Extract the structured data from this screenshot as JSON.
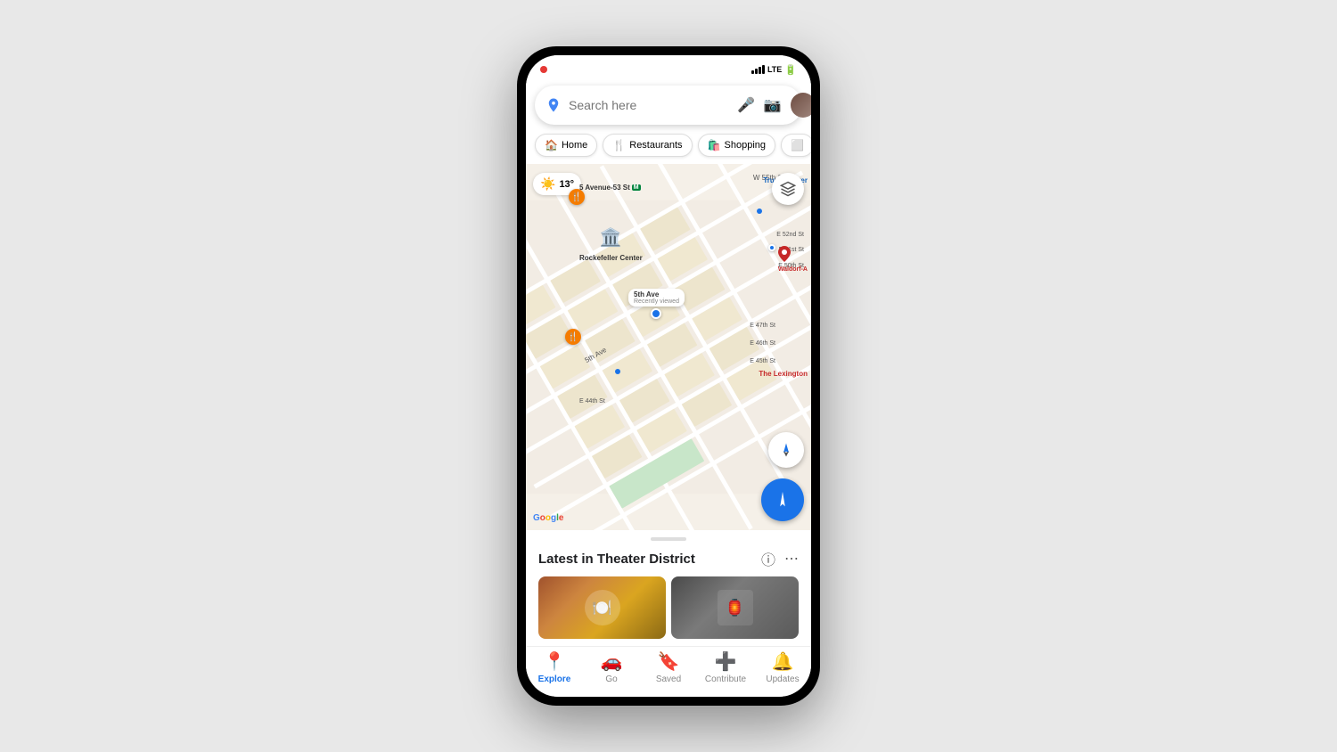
{
  "statusBar": {
    "signal": "LTE",
    "battery": "🔋"
  },
  "searchBar": {
    "placeholder": "Search here",
    "micLabel": "mic",
    "cameraLabel": "camera"
  },
  "chips": [
    {
      "id": "home",
      "icon": "🏠",
      "label": "Home"
    },
    {
      "id": "restaurants",
      "icon": "🍴",
      "label": "Restaurants"
    },
    {
      "id": "shopping",
      "icon": "🛍️",
      "label": "Shopping"
    }
  ],
  "map": {
    "weather": "13°",
    "labels": [
      {
        "text": "Rockefeller Center",
        "type": "landmark"
      },
      {
        "text": "5th Ave",
        "type": "street"
      },
      {
        "text": "Recently viewed",
        "type": "pin"
      },
      {
        "text": "Trump Tower",
        "type": "landmark-blue"
      },
      {
        "text": "Waldorf-A",
        "type": "landmark-red"
      },
      {
        "text": "The Lexington",
        "type": "landmark-red"
      },
      {
        "text": "W 55th St",
        "type": "street"
      },
      {
        "text": "E 52nd St",
        "type": "street"
      },
      {
        "text": "E 51st St",
        "type": "street"
      },
      {
        "text": "E 50th St",
        "type": "street"
      },
      {
        "text": "E 47th St",
        "type": "street"
      },
      {
        "text": "E 46th St",
        "type": "street"
      },
      {
        "text": "E 45th St",
        "type": "street"
      },
      {
        "text": "E 44th St",
        "type": "street"
      },
      {
        "text": "5 Avenue-53 St",
        "type": "metro"
      },
      {
        "text": "Google",
        "type": "watermark"
      }
    ]
  },
  "bottomPanel": {
    "title": "Latest in Theater District",
    "photos": [
      "food-photo",
      "interior-photo"
    ]
  },
  "bottomNav": [
    {
      "id": "explore",
      "icon": "📍",
      "label": "Explore",
      "active": true
    },
    {
      "id": "go",
      "icon": "🚗",
      "label": "Go",
      "active": false
    },
    {
      "id": "saved",
      "icon": "🔖",
      "label": "Saved",
      "active": false
    },
    {
      "id": "contribute",
      "icon": "➕",
      "label": "Contribute",
      "active": false
    },
    {
      "id": "updates",
      "icon": "🔔",
      "label": "Updates",
      "active": false
    }
  ]
}
